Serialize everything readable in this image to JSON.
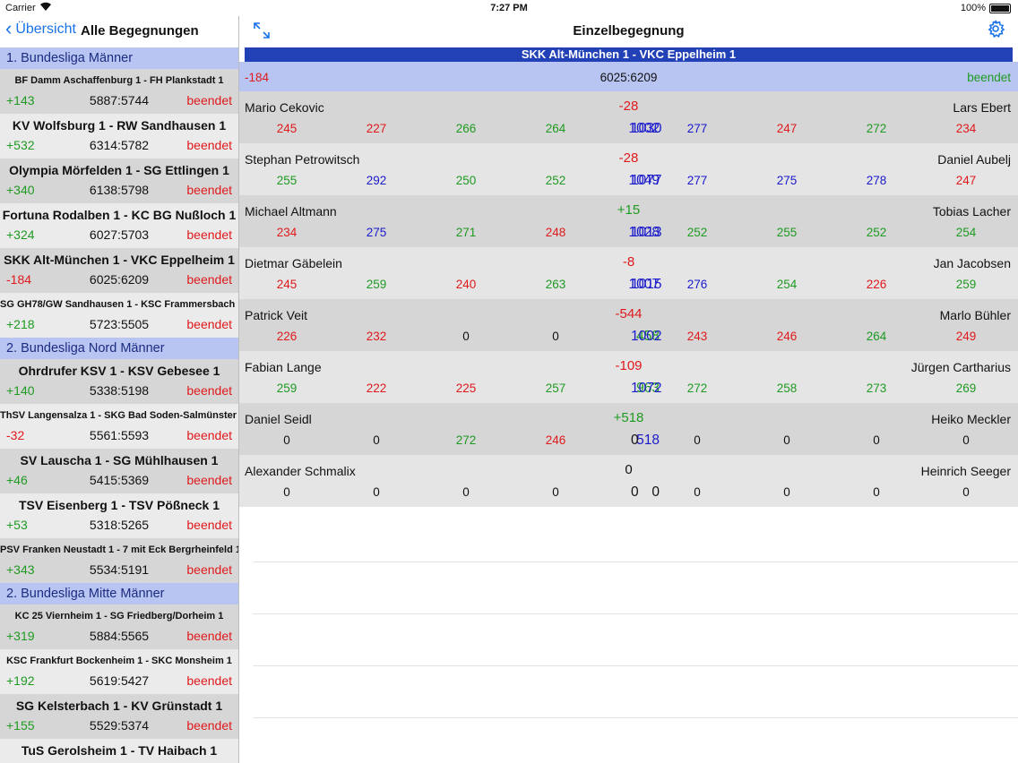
{
  "status_bar": {
    "carrier": "Carrier",
    "time": "7:27 PM",
    "battery": "100%"
  },
  "left": {
    "back_label": "Übersicht",
    "title": "Alle Begegnungen",
    "sections": [
      {
        "title": "1. Bundesliga Männer",
        "matches": [
          {
            "name": "BF Damm Aschaffenburg 1 - FH Plankstadt 1",
            "small": true,
            "diff": "+143",
            "score": "5887:5744",
            "status": "beendet"
          },
          {
            "name": "KV Wolfsburg 1 - RW Sandhausen 1",
            "small": false,
            "diff": "+532",
            "score": "6314:5782",
            "status": "beendet"
          },
          {
            "name": "Olympia Mörfelden 1 - SG Ettlingen 1",
            "small": false,
            "diff": "+340",
            "score": "6138:5798",
            "status": "beendet"
          },
          {
            "name": "Fortuna Rodalben 1 - KC BG Nußloch 1",
            "small": false,
            "diff": "+324",
            "score": "6027:5703",
            "status": "beendet"
          },
          {
            "name": "SKK Alt-München 1 - VKC Eppelheim 1",
            "small": false,
            "diff": "-184",
            "score": "6025:6209",
            "status": "beendet"
          },
          {
            "name": "SG GH78/GW Sandhausen 1 - KSC Frammersbach 1",
            "small": true,
            "diff": "+218",
            "score": "5723:5505",
            "status": "beendet"
          }
        ]
      },
      {
        "title": "2. Bundesliga Nord Männer",
        "matches": [
          {
            "name": "Ohrdrufer KSV 1 - KSV Gebesee 1",
            "small": false,
            "diff": "+140",
            "score": "5338:5198",
            "status": "beendet"
          },
          {
            "name": "ThSV Langensalza 1 - SKG Bad Soden-Salmünster 1",
            "small": true,
            "diff": "-32",
            "score": "5561:5593",
            "status": "beendet"
          },
          {
            "name": "SV Lauscha 1 - SG Mühlhausen 1",
            "small": false,
            "diff": "+46",
            "score": "5415:5369",
            "status": "beendet"
          },
          {
            "name": "TSV Eisenberg 1 - TSV Pößneck 1",
            "small": false,
            "diff": "+53",
            "score": "5318:5265",
            "status": "beendet"
          },
          {
            "name": "PSV Franken Neustadt 1 - 7 mit Eck Bergrheinfeld 1",
            "small": true,
            "diff": "+343",
            "score": "5534:5191",
            "status": "beendet"
          }
        ]
      },
      {
        "title": "2. Bundesliga Mitte Männer",
        "matches": [
          {
            "name": "KC 25 Viernheim 1 - SG Friedberg/Dorheim 1",
            "small": true,
            "diff": "+319",
            "score": "5884:5565",
            "status": "beendet"
          },
          {
            "name": "KSC Frankfurt Bockenheim 1 - SKC Monsheim 1",
            "small": true,
            "diff": "+192",
            "score": "5619:5427",
            "status": "beendet"
          },
          {
            "name": "SG Kelsterbach 1 - KV Grünstadt 1",
            "small": false,
            "diff": "+155",
            "score": "5529:5374",
            "status": "beendet"
          },
          {
            "name": "TuS Gerolsheim 1 - TV Haibach 1",
            "small": false,
            "diff": "",
            "score": "",
            "status": ""
          }
        ]
      }
    ]
  },
  "right": {
    "title": "Einzelbegegnung",
    "banner": "SKK Alt-München 1 - VKC Eppelheim 1",
    "summary": {
      "diff": "-184",
      "score": "6025:6209",
      "status": "beendet"
    },
    "games": [
      {
        "home": "Mario Cekovic",
        "away": "Lars Ebert",
        "diff": "-28",
        "diff_color": "neg",
        "hs": [
          [
            "245",
            "neg"
          ],
          [
            "227",
            "neg"
          ],
          [
            "266",
            "pos"
          ],
          [
            "264",
            "pos"
          ]
        ],
        "ht": [
          "1002",
          "blue"
        ],
        "at": [
          "1030",
          "blue"
        ],
        "as": [
          [
            "277",
            "blue"
          ],
          [
            "247",
            "neg"
          ],
          [
            "272",
            "pos"
          ],
          [
            "234",
            "neg"
          ]
        ]
      },
      {
        "home": "Stephan Petrowitsch",
        "away": "Daniel Aubelj",
        "diff": "-28",
        "diff_color": "neg",
        "hs": [
          [
            "255",
            "pos"
          ],
          [
            "292",
            "blue"
          ],
          [
            "250",
            "pos"
          ],
          [
            "252",
            "pos"
          ]
        ],
        "ht": [
          "1049",
          "blue"
        ],
        "at": [
          "1077",
          "blue"
        ],
        "as": [
          [
            "277",
            "blue"
          ],
          [
            "275",
            "blue"
          ],
          [
            "278",
            "blue"
          ],
          [
            "247",
            "neg"
          ]
        ]
      },
      {
        "home": "Michael Altmann",
        "away": "Tobias Lacher",
        "diff": "+15",
        "diff_color": "pos",
        "hs": [
          [
            "234",
            "neg"
          ],
          [
            "275",
            "blue"
          ],
          [
            "271",
            "pos"
          ],
          [
            "248",
            "neg"
          ]
        ],
        "ht": [
          "1028",
          "blue"
        ],
        "at": [
          "1013",
          "blue"
        ],
        "as": [
          [
            "252",
            "pos"
          ],
          [
            "255",
            "pos"
          ],
          [
            "252",
            "pos"
          ],
          [
            "254",
            "pos"
          ]
        ]
      },
      {
        "home": "Dietmar Gäbelein",
        "away": "Jan Jacobsen",
        "diff": "-8",
        "diff_color": "neg",
        "hs": [
          [
            "245",
            "neg"
          ],
          [
            "259",
            "pos"
          ],
          [
            "240",
            "neg"
          ],
          [
            "263",
            "pos"
          ]
        ],
        "ht": [
          "1007",
          "blue"
        ],
        "at": [
          "1015",
          "blue"
        ],
        "as": [
          [
            "276",
            "blue"
          ],
          [
            "254",
            "pos"
          ],
          [
            "226",
            "neg"
          ],
          [
            "259",
            "pos"
          ]
        ]
      },
      {
        "home": "Patrick Veit",
        "away": "Marlo Bühler",
        "diff": "-544",
        "diff_color": "neg",
        "hs": [
          [
            "226",
            "neg"
          ],
          [
            "232",
            "neg"
          ],
          [
            "0",
            "black"
          ],
          [
            "0",
            "black"
          ]
        ],
        "ht": [
          "458",
          "pos"
        ],
        "at": [
          "1002",
          "blue"
        ],
        "as": [
          [
            "243",
            "neg"
          ],
          [
            "246",
            "neg"
          ],
          [
            "264",
            "pos"
          ],
          [
            "249",
            "neg"
          ]
        ]
      },
      {
        "home": "Fabian Lange",
        "away": "Jürgen Cartharius",
        "diff": "-109",
        "diff_color": "neg",
        "hs": [
          [
            "259",
            "pos"
          ],
          [
            "222",
            "neg"
          ],
          [
            "225",
            "neg"
          ],
          [
            "257",
            "pos"
          ]
        ],
        "ht": [
          "963",
          "pos"
        ],
        "at": [
          "1072",
          "blue"
        ],
        "as": [
          [
            "272",
            "pos"
          ],
          [
            "258",
            "pos"
          ],
          [
            "273",
            "pos"
          ],
          [
            "269",
            "pos"
          ]
        ]
      },
      {
        "home": "Daniel Seidl",
        "away": "Heiko Meckler",
        "diff": "+518",
        "diff_color": "pos",
        "hs": [
          [
            "0",
            "black"
          ],
          [
            "0",
            "black"
          ],
          [
            "272",
            "pos"
          ],
          [
            "246",
            "neg"
          ]
        ],
        "ht": [
          "518",
          "blue"
        ],
        "at": [
          "0",
          "black"
        ],
        "as": [
          [
            "0",
            "black"
          ],
          [
            "0",
            "black"
          ],
          [
            "0",
            "black"
          ],
          [
            "0",
            "black"
          ]
        ]
      },
      {
        "home": "Alexander Schmalix",
        "away": "Heinrich Seeger",
        "diff": "0",
        "diff_color": "black",
        "hs": [
          [
            "0",
            "black"
          ],
          [
            "0",
            "black"
          ],
          [
            "0",
            "black"
          ],
          [
            "0",
            "black"
          ]
        ],
        "ht": [
          "0",
          "black"
        ],
        "at": [
          "0",
          "black"
        ],
        "as": [
          [
            "0",
            "black"
          ],
          [
            "0",
            "black"
          ],
          [
            "0",
            "black"
          ],
          [
            "0",
            "black"
          ]
        ]
      }
    ]
  }
}
